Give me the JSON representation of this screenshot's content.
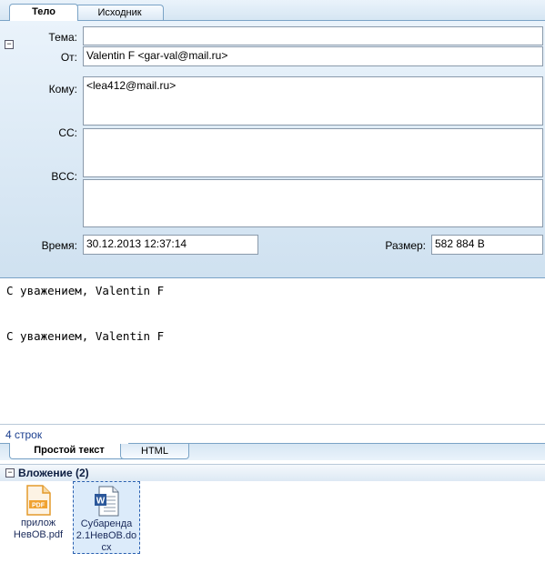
{
  "top_tabs": [
    "Тело",
    "Исходник"
  ],
  "headers": {
    "subject_label": "Тема:",
    "subject_value": "",
    "from_label": "От:",
    "from_value": "Valentin F <gar-val@mail.ru>",
    "to_label": "Кому:",
    "to_value": "<lea412@mail.ru>",
    "cc_label": "CC:",
    "cc_value": "",
    "bcc_label": "BCC:",
    "bcc_value": "",
    "time_label": "Время:",
    "time_value": "30.12.2013 12:37:14",
    "size_label": "Размер:",
    "size_value": "582 884 B"
  },
  "body_lines": [
    "С уважением, Valentin F",
    "С уважением, Valentin F"
  ],
  "status_text": "4 строк",
  "bottom_tabs": [
    "Простой текст",
    "HTML"
  ],
  "attachments": {
    "title": "Вложение (2)",
    "items": [
      {
        "name": "прилож НевОВ.pdf",
        "icon": "pdf-icon",
        "badge": "PDF"
      },
      {
        "name": "Субаренда 2.1НевОВ.docx",
        "icon": "word-doc-icon",
        "badge": "W"
      }
    ]
  },
  "colors": {
    "pdf": "#f0a232",
    "word": "#2b579a",
    "accent": "#7aa3c6"
  }
}
